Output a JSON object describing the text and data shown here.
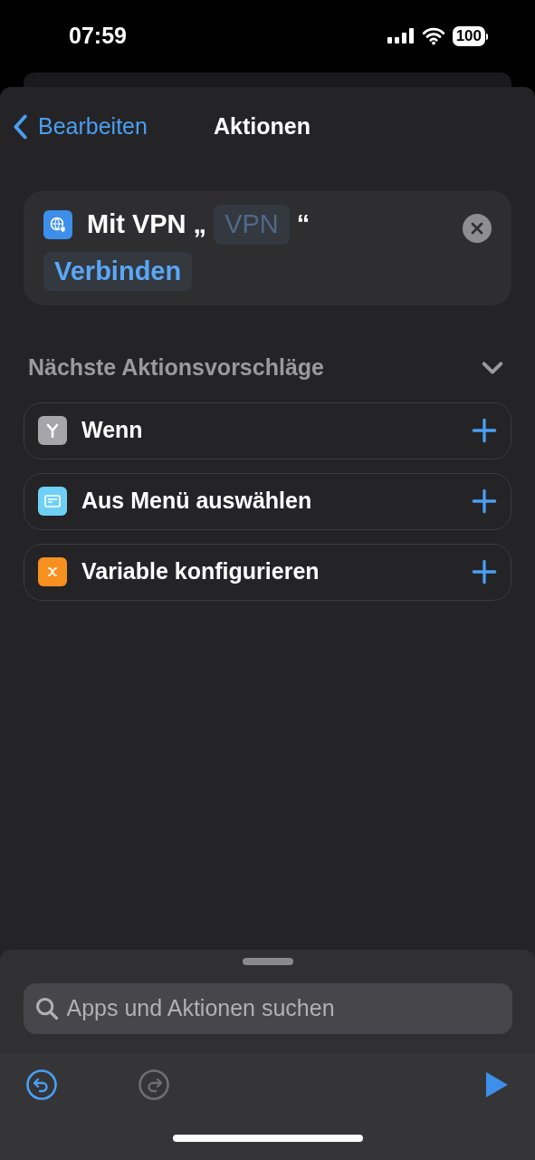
{
  "status_bar": {
    "time": "07:59",
    "battery": "100"
  },
  "nav": {
    "back": "Bearbeiten",
    "title": "Aktionen"
  },
  "action": {
    "prefix": "Mit VPN „",
    "vpn_token": "VPN",
    "vpn_token_placeholder": true,
    "suffix": "“",
    "verb_token": "Verbinden"
  },
  "suggestions": {
    "title": "Nächste Aktionsvorschläge",
    "expanded": true,
    "items": [
      {
        "kind": "branch",
        "label": "Wenn",
        "color": "#a5a5aa"
      },
      {
        "kind": "menu",
        "label": "Aus Menü auswählen",
        "color": "#6fd0f5"
      },
      {
        "kind": "variable",
        "label": "Variable konfigurieren",
        "color": "#f7901e"
      }
    ]
  },
  "search": {
    "placeholder": "Apps und Aktionen suchen"
  },
  "toolbar": {
    "undo": {
      "disabled": false
    },
    "redo": {
      "disabled": true
    }
  }
}
